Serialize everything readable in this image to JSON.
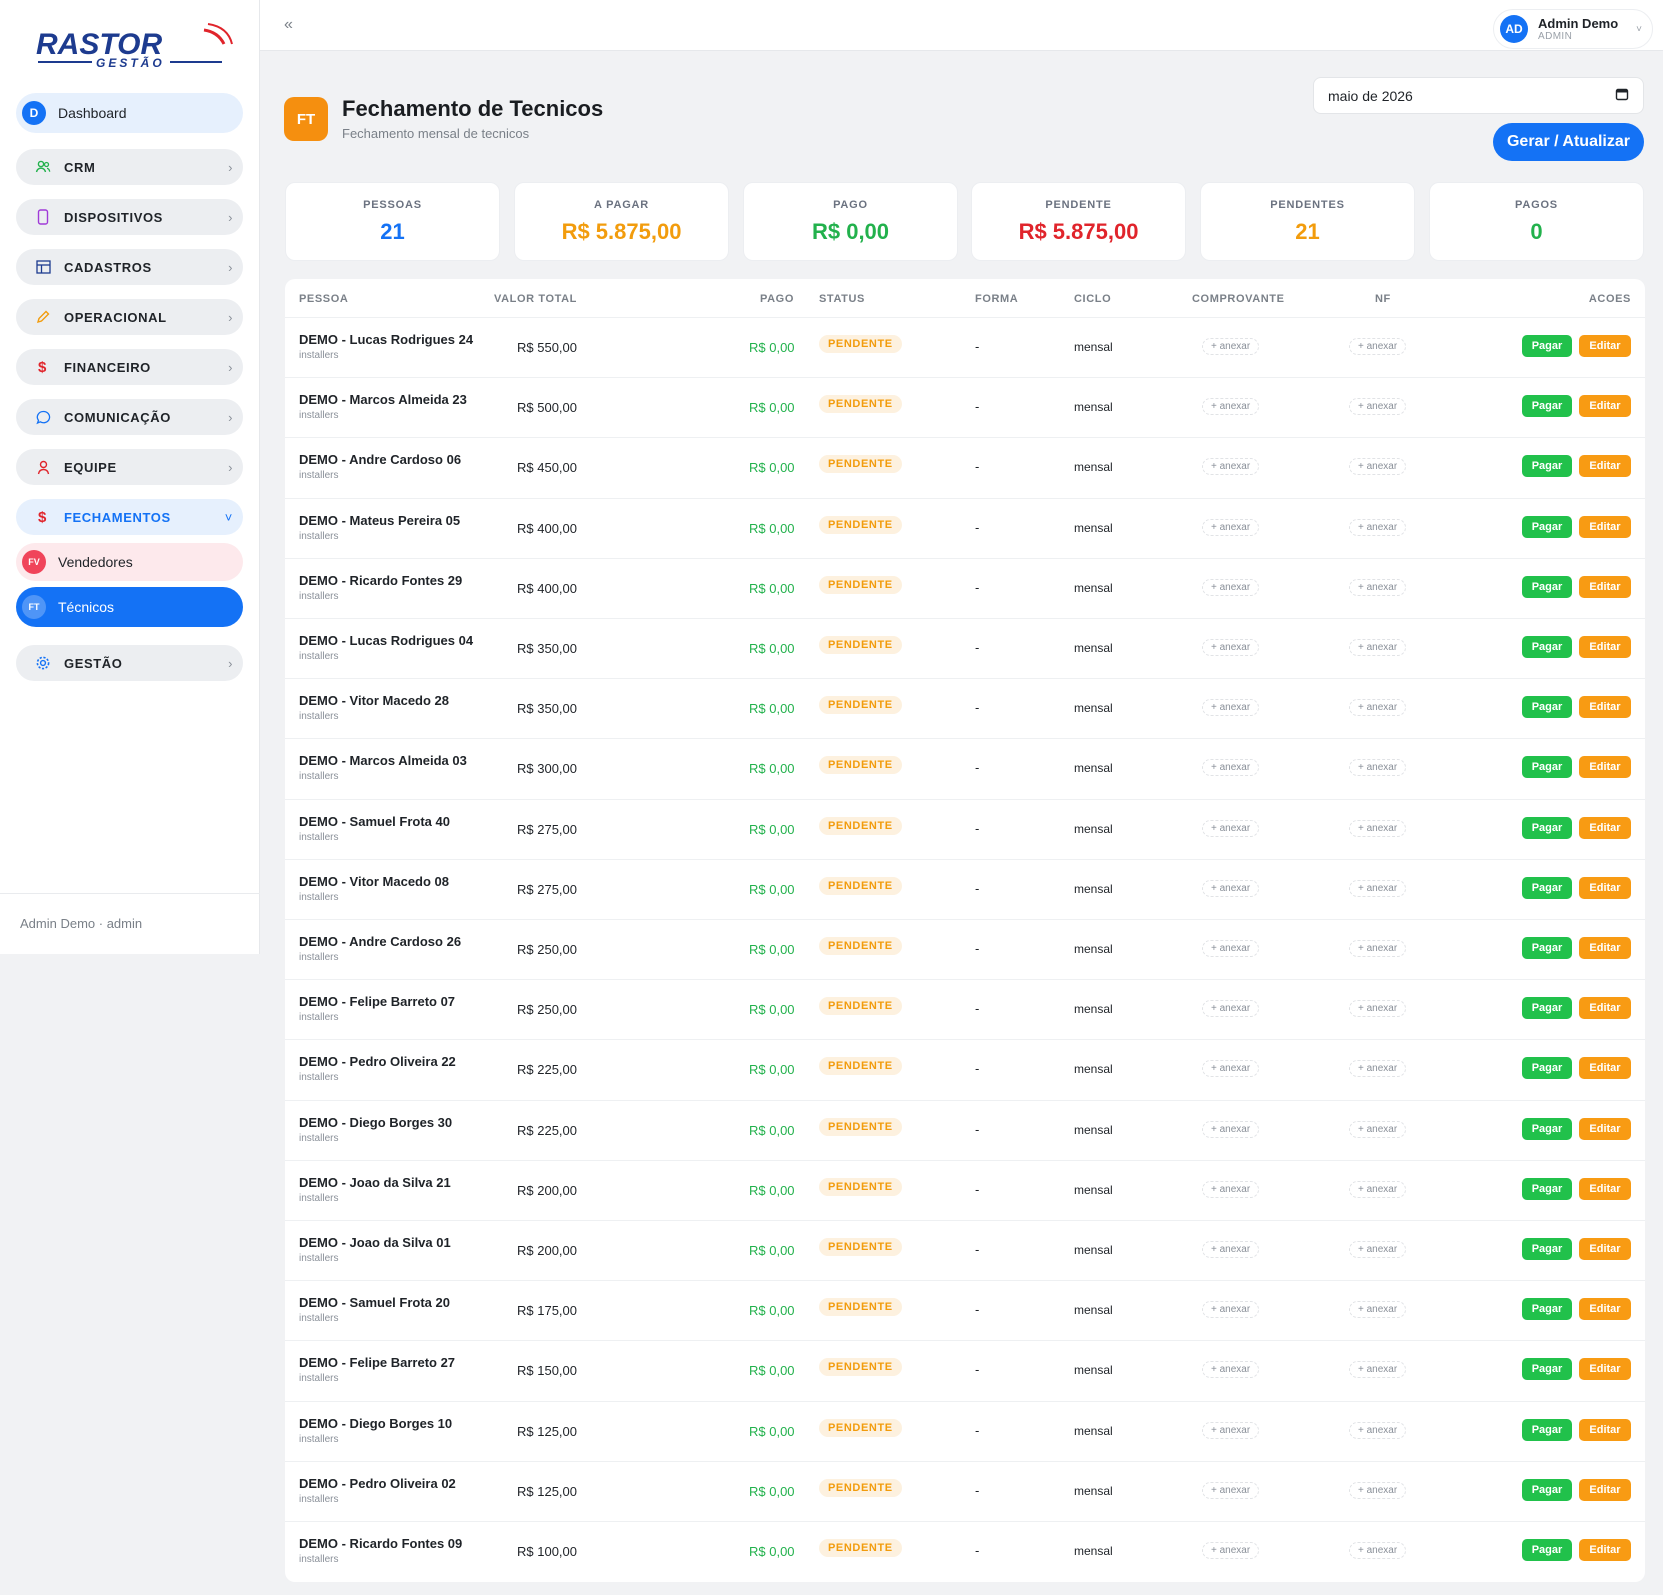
{
  "brand": {
    "logo_text": "RASTOR",
    "logo_sub": "GESTÃO",
    "accent": "#1472f5",
    "logo_red": "#e0242b",
    "logo_blue": "#1d3b8f"
  },
  "sidebar": {
    "items": [
      {
        "label": "Dashboard",
        "avatar": "D",
        "type": "avatar",
        "avatar_color": "#1472f5",
        "icon": "dashboard-avatar"
      },
      {
        "label": "CRM",
        "icon": "users-icon",
        "icon_color": "#22b14c"
      },
      {
        "label": "DISPOSITIVOS",
        "icon": "phone-icon",
        "icon_color": "#a03ad8"
      },
      {
        "label": "CADASTROS",
        "icon": "table-icon",
        "icon_color": "#1d3b8f"
      },
      {
        "label": "OPERACIONAL",
        "icon": "pencil-icon",
        "icon_color": "#f29c0d"
      },
      {
        "label": "FINANCEIRO",
        "icon": "dollar-icon",
        "icon_color": "#e0242b"
      },
      {
        "label": "COMUNICAÇÃO",
        "icon": "chat-icon",
        "icon_color": "#1472f5"
      },
      {
        "label": "EQUIPE",
        "icon": "person-icon",
        "icon_color": "#e0242b"
      },
      {
        "label": "FECHAMENTOS",
        "icon": "dollar-icon",
        "icon_color": "#e0242b",
        "expanded": true
      },
      {
        "label": "Vendedores",
        "avatar": "FV",
        "avatar_color": "#f0445a"
      },
      {
        "label": "Técnicos",
        "avatar": "FT",
        "avatar_color": "#1472f5",
        "active": true
      },
      {
        "label": "GESTÃO",
        "icon": "gear-icon",
        "icon_color": "#1472f5"
      }
    ],
    "chev": "›",
    "chev_open": "˅",
    "footer": "Admin Demo · admin"
  },
  "topbar": {
    "collapse": "«",
    "user_initials": "AD",
    "user_name": "Admin Demo",
    "user_role": "ADMIN",
    "dropdown": "˅"
  },
  "page": {
    "icon": "FT",
    "title": "Fechamento de Tecnicos",
    "subtitle": "Fechamento mensal de tecnicos",
    "month": "maio de 2026",
    "generate": "Gerar / Atualizar"
  },
  "summary": [
    {
      "label": "PESSOAS",
      "value": "21",
      "color": "#1472f5"
    },
    {
      "label": "A PAGAR",
      "value": "R$ 5.875,00",
      "color": "#f29c0d"
    },
    {
      "label": "PAGO",
      "value": "R$ 0,00",
      "color": "#22b14c"
    },
    {
      "label": "PENDENTE",
      "value": "R$ 5.875,00",
      "color": "#e0242b"
    },
    {
      "label": "PENDENTES",
      "value": "21",
      "color": "#f29c0d"
    },
    {
      "label": "PAGOS",
      "value": "0",
      "color": "#22b14c"
    }
  ],
  "table": {
    "columns": [
      "PESSOA",
      "VALOR TOTAL",
      "PAGO",
      "STATUS",
      "FORMA",
      "CICLO",
      "COMPROVANTE",
      "NF",
      "ACOES"
    ],
    "rows": [
      {
        "name": "DEMO - Lucas Rodrigues 24",
        "role": "installers",
        "total": "R$ 550,00",
        "paid": "R$ 0,00",
        "status": "PENDENTE",
        "forma": "-",
        "ciclo": "mensal",
        "comprovante": "+ anexar",
        "nf": "+ anexar",
        "pay": "Pagar",
        "edit": "Editar"
      },
      {
        "name": "DEMO - Marcos Almeida 23",
        "role": "installers",
        "total": "R$ 500,00",
        "paid": "R$ 0,00",
        "status": "PENDENTE",
        "forma": "-",
        "ciclo": "mensal",
        "comprovante": "+ anexar",
        "nf": "+ anexar",
        "pay": "Pagar",
        "edit": "Editar"
      },
      {
        "name": "DEMO - Andre Cardoso 06",
        "role": "installers",
        "total": "R$ 450,00",
        "paid": "R$ 0,00",
        "status": "PENDENTE",
        "forma": "-",
        "ciclo": "mensal",
        "comprovante": "+ anexar",
        "nf": "+ anexar",
        "pay": "Pagar",
        "edit": "Editar"
      },
      {
        "name": "DEMO - Mateus Pereira 05",
        "role": "installers",
        "total": "R$ 400,00",
        "paid": "R$ 0,00",
        "status": "PENDENTE",
        "forma": "-",
        "ciclo": "mensal",
        "comprovante": "+ anexar",
        "nf": "+ anexar",
        "pay": "Pagar",
        "edit": "Editar"
      },
      {
        "name": "DEMO - Ricardo Fontes 29",
        "role": "installers",
        "total": "R$ 400,00",
        "paid": "R$ 0,00",
        "status": "PENDENTE",
        "forma": "-",
        "ciclo": "mensal",
        "comprovante": "+ anexar",
        "nf": "+ anexar",
        "pay": "Pagar",
        "edit": "Editar"
      },
      {
        "name": "DEMO - Lucas Rodrigues 04",
        "role": "installers",
        "total": "R$ 350,00",
        "paid": "R$ 0,00",
        "status": "PENDENTE",
        "forma": "-",
        "ciclo": "mensal",
        "comprovante": "+ anexar",
        "nf": "+ anexar",
        "pay": "Pagar",
        "edit": "Editar"
      },
      {
        "name": "DEMO - Vitor Macedo 28",
        "role": "installers",
        "total": "R$ 350,00",
        "paid": "R$ 0,00",
        "status": "PENDENTE",
        "forma": "-",
        "ciclo": "mensal",
        "comprovante": "+ anexar",
        "nf": "+ anexar",
        "pay": "Pagar",
        "edit": "Editar"
      },
      {
        "name": "DEMO - Marcos Almeida 03",
        "role": "installers",
        "total": "R$ 300,00",
        "paid": "R$ 0,00",
        "status": "PENDENTE",
        "forma": "-",
        "ciclo": "mensal",
        "comprovante": "+ anexar",
        "nf": "+ anexar",
        "pay": "Pagar",
        "edit": "Editar"
      },
      {
        "name": "DEMO - Samuel Frota 40",
        "role": "installers",
        "total": "R$ 275,00",
        "paid": "R$ 0,00",
        "status": "PENDENTE",
        "forma": "-",
        "ciclo": "mensal",
        "comprovante": "+ anexar",
        "nf": "+ anexar",
        "pay": "Pagar",
        "edit": "Editar"
      },
      {
        "name": "DEMO - Vitor Macedo 08",
        "role": "installers",
        "total": "R$ 275,00",
        "paid": "R$ 0,00",
        "status": "PENDENTE",
        "forma": "-",
        "ciclo": "mensal",
        "comprovante": "+ anexar",
        "nf": "+ anexar",
        "pay": "Pagar",
        "edit": "Editar"
      },
      {
        "name": "DEMO - Andre Cardoso 26",
        "role": "installers",
        "total": "R$ 250,00",
        "paid": "R$ 0,00",
        "status": "PENDENTE",
        "forma": "-",
        "ciclo": "mensal",
        "comprovante": "+ anexar",
        "nf": "+ anexar",
        "pay": "Pagar",
        "edit": "Editar"
      },
      {
        "name": "DEMO - Felipe Barreto 07",
        "role": "installers",
        "total": "R$ 250,00",
        "paid": "R$ 0,00",
        "status": "PENDENTE",
        "forma": "-",
        "ciclo": "mensal",
        "comprovante": "+ anexar",
        "nf": "+ anexar",
        "pay": "Pagar",
        "edit": "Editar"
      },
      {
        "name": "DEMO - Pedro Oliveira 22",
        "role": "installers",
        "total": "R$ 225,00",
        "paid": "R$ 0,00",
        "status": "PENDENTE",
        "forma": "-",
        "ciclo": "mensal",
        "comprovante": "+ anexar",
        "nf": "+ anexar",
        "pay": "Pagar",
        "edit": "Editar"
      },
      {
        "name": "DEMO - Diego Borges 30",
        "role": "installers",
        "total": "R$ 225,00",
        "paid": "R$ 0,00",
        "status": "PENDENTE",
        "forma": "-",
        "ciclo": "mensal",
        "comprovante": "+ anexar",
        "nf": "+ anexar",
        "pay": "Pagar",
        "edit": "Editar"
      },
      {
        "name": "DEMO - Joao da Silva 21",
        "role": "installers",
        "total": "R$ 200,00",
        "paid": "R$ 0,00",
        "status": "PENDENTE",
        "forma": "-",
        "ciclo": "mensal",
        "comprovante": "+ anexar",
        "nf": "+ anexar",
        "pay": "Pagar",
        "edit": "Editar"
      },
      {
        "name": "DEMO - Joao da Silva 01",
        "role": "installers",
        "total": "R$ 200,00",
        "paid": "R$ 0,00",
        "status": "PENDENTE",
        "forma": "-",
        "ciclo": "mensal",
        "comprovante": "+ anexar",
        "nf": "+ anexar",
        "pay": "Pagar",
        "edit": "Editar"
      },
      {
        "name": "DEMO - Samuel Frota 20",
        "role": "installers",
        "total": "R$ 175,00",
        "paid": "R$ 0,00",
        "status": "PENDENTE",
        "forma": "-",
        "ciclo": "mensal",
        "comprovante": "+ anexar",
        "nf": "+ anexar",
        "pay": "Pagar",
        "edit": "Editar"
      },
      {
        "name": "DEMO - Felipe Barreto 27",
        "role": "installers",
        "total": "R$ 150,00",
        "paid": "R$ 0,00",
        "status": "PENDENTE",
        "forma": "-",
        "ciclo": "mensal",
        "comprovante": "+ anexar",
        "nf": "+ anexar",
        "pay": "Pagar",
        "edit": "Editar"
      },
      {
        "name": "DEMO - Diego Borges 10",
        "role": "installers",
        "total": "R$ 125,00",
        "paid": "R$ 0,00",
        "status": "PENDENTE",
        "forma": "-",
        "ciclo": "mensal",
        "comprovante": "+ anexar",
        "nf": "+ anexar",
        "pay": "Pagar",
        "edit": "Editar"
      },
      {
        "name": "DEMO - Pedro Oliveira 02",
        "role": "installers",
        "total": "R$ 125,00",
        "paid": "R$ 0,00",
        "status": "PENDENTE",
        "forma": "-",
        "ciclo": "mensal",
        "comprovante": "+ anexar",
        "nf": "+ anexar",
        "pay": "Pagar",
        "edit": "Editar"
      },
      {
        "name": "DEMO - Ricardo Fontes 09",
        "role": "installers",
        "total": "R$ 100,00",
        "paid": "R$ 0,00",
        "status": "PENDENTE",
        "forma": "-",
        "ciclo": "mensal",
        "comprovante": "+ anexar",
        "nf": "+ anexar",
        "pay": "Pagar",
        "edit": "Editar"
      }
    ]
  }
}
